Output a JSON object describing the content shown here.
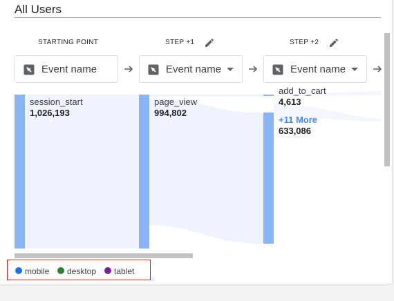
{
  "title": "All Users",
  "steps": [
    {
      "label": "STARTING POINT",
      "selector": "Event name",
      "editable": false,
      "dropdown": false
    },
    {
      "label": "STEP +1",
      "selector": "Event name",
      "editable": true,
      "dropdown": true
    },
    {
      "label": "STEP +2",
      "selector": "Event name",
      "editable": true,
      "dropdown": true
    }
  ],
  "nodes": {
    "start": {
      "name": "session_start",
      "count": "1,026,193"
    },
    "step1": {
      "name": "page_view",
      "count": "994,802"
    },
    "step2_a": {
      "name": "add_to_cart",
      "count": "4,613"
    },
    "step2_more": {
      "name": "+11 More",
      "count": "633,086"
    }
  },
  "legend": [
    {
      "label": "mobile",
      "color": "#1a73e8"
    },
    {
      "label": "desktop",
      "color": "#2e7d32"
    },
    {
      "label": "tablet",
      "color": "#7b1fa2"
    }
  ],
  "colors": {
    "node_bar": "#8ab4f8",
    "flow_fill": "#eef3fd",
    "link": "#4285f4"
  },
  "icons": {
    "edit": "pencil-icon",
    "cursor": "cursor-select-icon",
    "arrow": "arrow-right-icon",
    "caret": "caret-down-icon"
  }
}
